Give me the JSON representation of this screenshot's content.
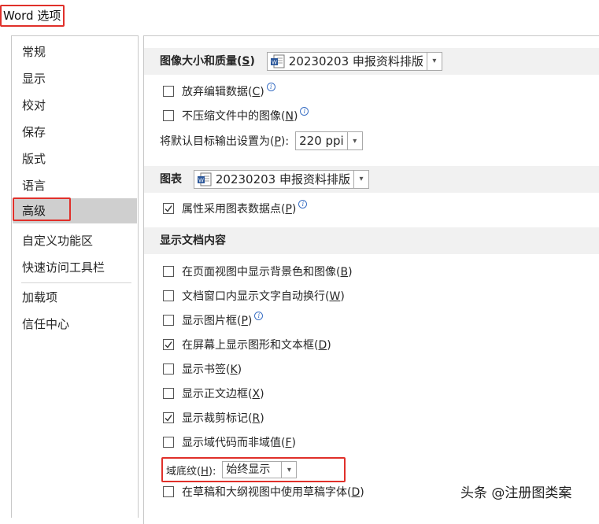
{
  "window": {
    "title": "Word 选项"
  },
  "sidebar": {
    "items": [
      {
        "label": "常规"
      },
      {
        "label": "显示"
      },
      {
        "label": "校对"
      },
      {
        "label": "保存"
      },
      {
        "label": "版式"
      },
      {
        "label": "语言"
      },
      {
        "label": "高级",
        "selected": true
      },
      {
        "label": "自定义功能区"
      },
      {
        "label": "快速访问工具栏"
      },
      {
        "label": "加载项"
      },
      {
        "label": "信任中心"
      }
    ]
  },
  "image_quality": {
    "heading": "图像大小和质量",
    "heading_key": "S",
    "document": "20230203 申报资料排版",
    "discard_edit": {
      "label": "放弃编辑数据",
      "key": "C",
      "checked": false
    },
    "no_compress": {
      "label": "不压缩文件中的图像",
      "key": "N",
      "checked": false
    },
    "default_resolution_label": "将默认目标输出设置为",
    "default_resolution_key": "P",
    "default_resolution_suffix": ":",
    "default_resolution_value": "220 ppi"
  },
  "chart": {
    "heading": "图表",
    "document": "20230203 申报资料排版",
    "properties_follow": {
      "label": "属性采用图表数据点",
      "key": "P",
      "checked": true
    }
  },
  "display_content": {
    "heading": "显示文档内容",
    "options": [
      {
        "label": "在页面视图中显示背景色和图像",
        "key": "B",
        "checked": false
      },
      {
        "label": "文档窗口内显示文字自动换行",
        "key": "W",
        "checked": false
      },
      {
        "label": "显示图片框",
        "key": "P",
        "checked": false,
        "info": true
      },
      {
        "label": "在屏幕上显示图形和文本框",
        "key": "D",
        "checked": true
      },
      {
        "label": "显示书签",
        "key": "K",
        "checked": false
      },
      {
        "label": "显示正文边框",
        "key": "X",
        "checked": false
      },
      {
        "label": "显示裁剪标记",
        "key": "R",
        "checked": true
      },
      {
        "label": "显示域代码而非域值",
        "key": "F",
        "checked": false
      }
    ],
    "field_shading_label": "域底纹",
    "field_shading_key": "H",
    "field_shading_suffix": ":",
    "field_shading_value": "始终显示",
    "draft_font": {
      "label": "在草稿和大纲视图中使用草稿字体",
      "key": "D",
      "checked": false
    }
  },
  "watermark": {
    "text": "头条 @注册图类案"
  },
  "icons": {
    "doc": "word-document-icon",
    "dropdown": "chevron-down-icon",
    "info": "info-icon",
    "check": "checkmark-icon"
  },
  "colors": {
    "highlight_box": "#e0302a",
    "section_bg": "#f1f1f1",
    "selected_nav": "#cfcfcf"
  }
}
